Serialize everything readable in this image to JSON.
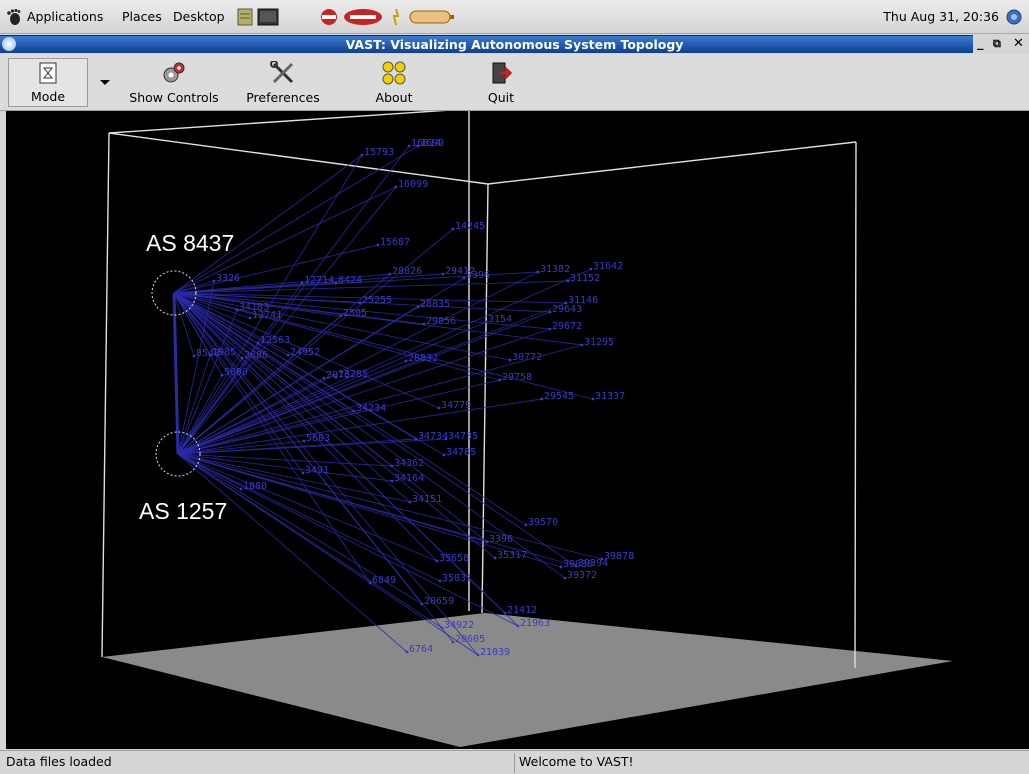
{
  "panel": {
    "menus": [
      "Applications",
      "Places",
      "Desktop"
    ],
    "clock": "Thu Aug 31, 20:36"
  },
  "window": {
    "title": "VAST: Visualizing Autonomous System Topology",
    "controls": [
      "_",
      "⧉",
      "✕"
    ]
  },
  "toolbar": {
    "mode_label": "Mode",
    "show_controls_label": "Show Controls",
    "preferences_label": "Preferences",
    "about_label": "About",
    "quit_label": "Quit"
  },
  "viz": {
    "as_top_label": "AS 8437",
    "as_bottom_label": "AS 1257",
    "link_color": "#2b2ba8",
    "label_color": "#3a3ac8",
    "floor_color": "#8a8a8a",
    "node_labels": [
      "15793",
      "16814",
      "1690",
      "16099",
      "15687",
      "14245",
      "3326",
      "12714",
      "8424",
      "28826",
      "29412",
      "3396",
      "31382",
      "31642",
      "31152",
      "31146",
      "25255",
      "28835",
      "29643",
      "34183",
      "12741",
      "2505",
      "29056",
      "3154",
      "29672",
      "12563",
      "24952",
      "31295",
      "8543",
      "2686",
      "1985",
      "28832",
      "30772",
      "5690",
      "13285",
      "2076",
      "29758",
      "29545",
      "31337",
      "34234",
      "34779",
      "5603",
      "34734",
      "34735",
      "34785",
      "34362",
      "3491",
      "34164",
      "34151",
      "1880",
      "39570",
      "3396",
      "35317",
      "39030",
      "39394",
      "39878",
      "39372",
      "35658",
      "6849",
      "35031",
      "20659",
      "34922",
      "21412",
      "21963",
      "20605",
      "6764",
      "21039"
    ]
  },
  "status": {
    "left": "Data files loaded",
    "right": "Welcome to VAST!"
  }
}
